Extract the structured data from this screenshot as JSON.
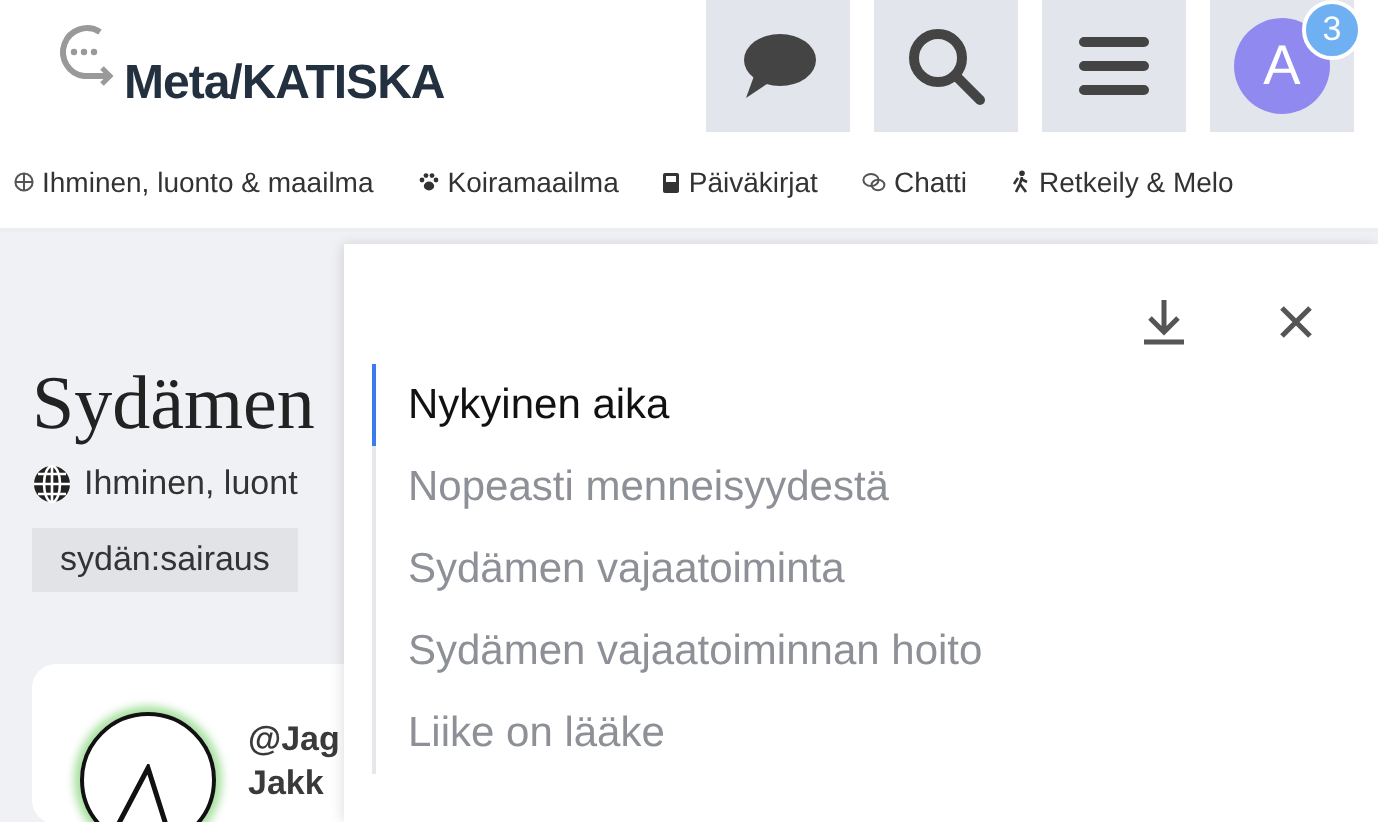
{
  "header": {
    "site_title": "Meta/KATISKA",
    "notification_count": "3",
    "avatar_letter": "A"
  },
  "categories": [
    {
      "kind": "globe",
      "label": "Ihminen, luonto & maailma"
    },
    {
      "kind": "paw",
      "label": "Koiramaailma"
    },
    {
      "kind": "book",
      "label": "Päiväkirjat"
    },
    {
      "kind": "chat",
      "label": "Chatti"
    },
    {
      "kind": "hiker",
      "label": "Retkeily & Melo"
    }
  ],
  "topic": {
    "title": "Sydämen",
    "category": "Ihminen, luont",
    "tag": "sydän:sairaus"
  },
  "post": {
    "username": "@Jag",
    "name": "Jakk"
  },
  "toc": [
    {
      "label": "Nykyinen aika",
      "selected": true
    },
    {
      "label": "Nopeasti menneisyydestä",
      "selected": false
    },
    {
      "label": "Sydämen vajaatoiminta",
      "selected": false
    },
    {
      "label": "Sydämen vajaatoiminnan hoito",
      "selected": false
    },
    {
      "label": "Liike on lääke",
      "selected": false
    }
  ]
}
